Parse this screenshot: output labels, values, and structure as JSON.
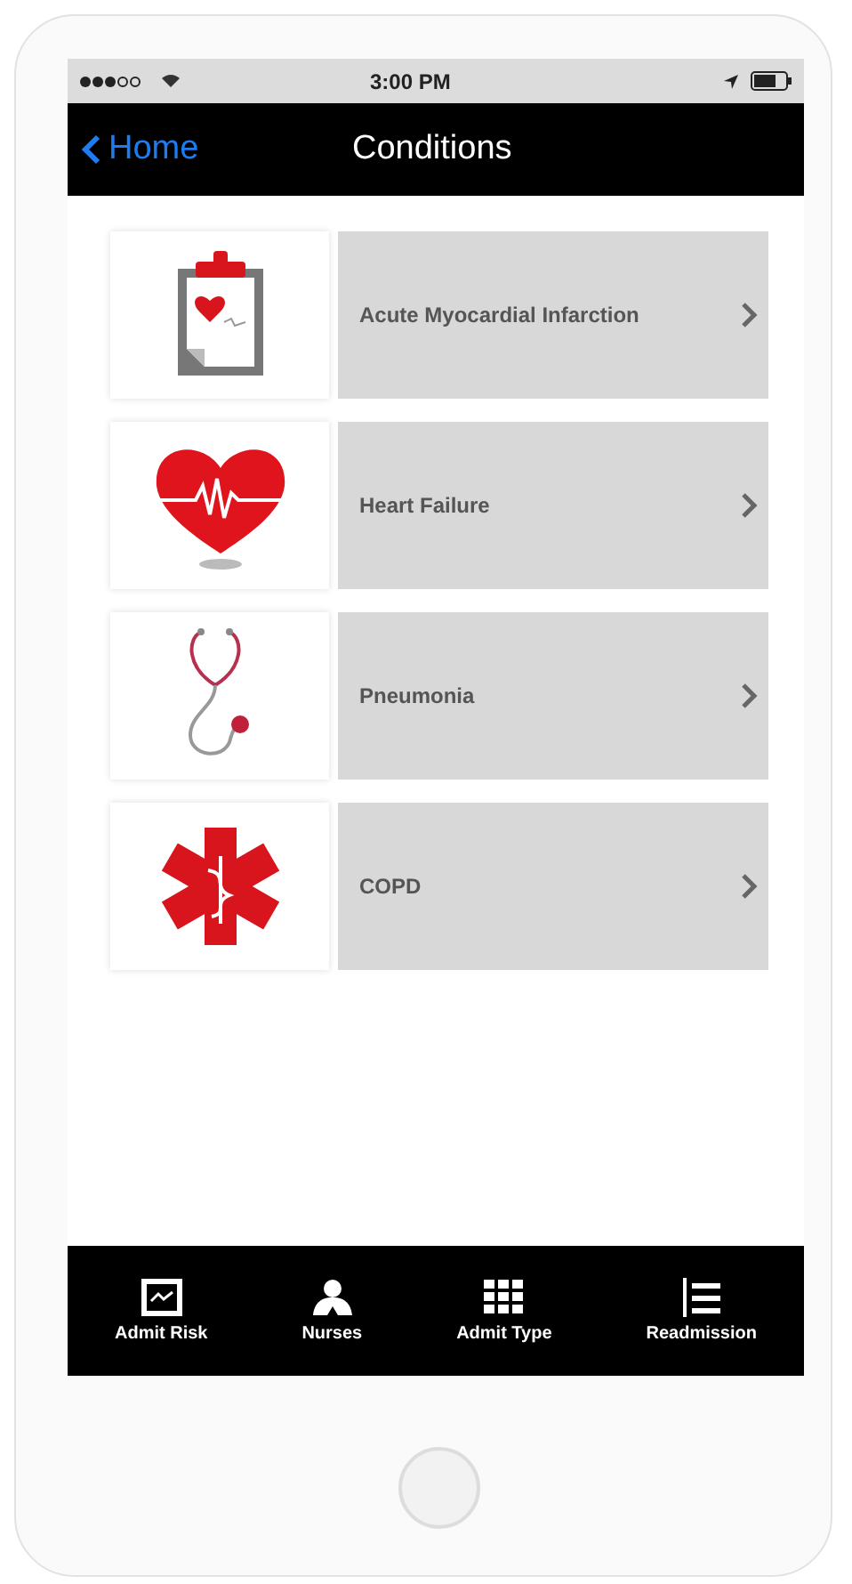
{
  "status_bar": {
    "time": "3:00 PM"
  },
  "nav_bar": {
    "back": "Home",
    "title": "Conditions"
  },
  "conditions": [
    {
      "kind": "clipboard",
      "label": "Acute Myocardial Infarction"
    },
    {
      "kind": "heart",
      "label": "Heart Failure"
    },
    {
      "kind": "stethoscope",
      "label": "Pneumonia"
    },
    {
      "kind": "star-of-life",
      "label": "COPD"
    }
  ],
  "tab_bar": [
    {
      "kind": "chart",
      "label": "Admit Risk"
    },
    {
      "kind": "person",
      "label": "Nurses"
    },
    {
      "kind": "grid",
      "label": "Admit Type"
    },
    {
      "kind": "list",
      "label": "Readmission"
    }
  ]
}
